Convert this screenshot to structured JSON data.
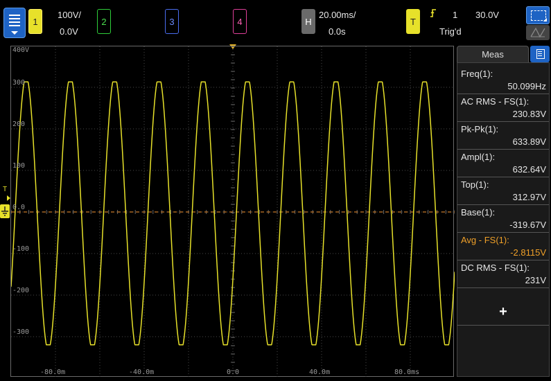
{
  "top_bar": {
    "menu_label": "",
    "channels": [
      {
        "id": "1",
        "scale": "100V/",
        "offset": "0.0V",
        "color": "#e7e12a"
      },
      {
        "id": "2",
        "color": "#2fcf3a"
      },
      {
        "id": "3",
        "color": "#4a6df0"
      },
      {
        "id": "4",
        "color": "#e0409a"
      }
    ],
    "horizontal": {
      "label": "H",
      "timebase": "20.00ms/",
      "delay": "0.0s"
    },
    "trigger": {
      "label": "T",
      "source": "1",
      "level": "30.0V",
      "status": "Trig'd"
    }
  },
  "graticule": {
    "y_labels": [
      "400V",
      "300",
      "200",
      "100",
      "0.0",
      "-100",
      "-200",
      "-300"
    ],
    "x_labels": [
      "-80.0m",
      "-40.0m",
      "0.0",
      "40.0m",
      "80.0ms"
    ],
    "trigger_marker": "T",
    "trace_color": "#e7e12a",
    "grid_color": "#4a4a4a",
    "cursor_color": "#c87a28"
  },
  "chart_data": {
    "type": "line",
    "waveform": "sine",
    "frequency_hz": 50.099,
    "top_v": 312.97,
    "base_v": -319.67,
    "xlim_ms": [
      -100,
      100
    ],
    "ylim_v": [
      -400,
      400
    ],
    "x_unit": "ms",
    "y_unit": "V"
  },
  "measurements": {
    "tab_label": "Meas",
    "items": [
      {
        "label": "Freq(1):",
        "value": "50.099Hz",
        "highlight": false
      },
      {
        "label": "AC RMS - FS(1):",
        "value": "230.83V",
        "highlight": false
      },
      {
        "label": "Pk-Pk(1):",
        "value": "633.89V",
        "highlight": false
      },
      {
        "label": "Ampl(1):",
        "value": "632.64V",
        "highlight": false
      },
      {
        "label": "Top(1):",
        "value": "312.97V",
        "highlight": false
      },
      {
        "label": "Base(1):",
        "value": "-319.67V",
        "highlight": false
      },
      {
        "label": "Avg - FS(1):",
        "value": "-2.8115V",
        "highlight": true
      },
      {
        "label": "DC RMS - FS(1):",
        "value": "231V",
        "highlight": false
      }
    ],
    "add_label": "+"
  }
}
